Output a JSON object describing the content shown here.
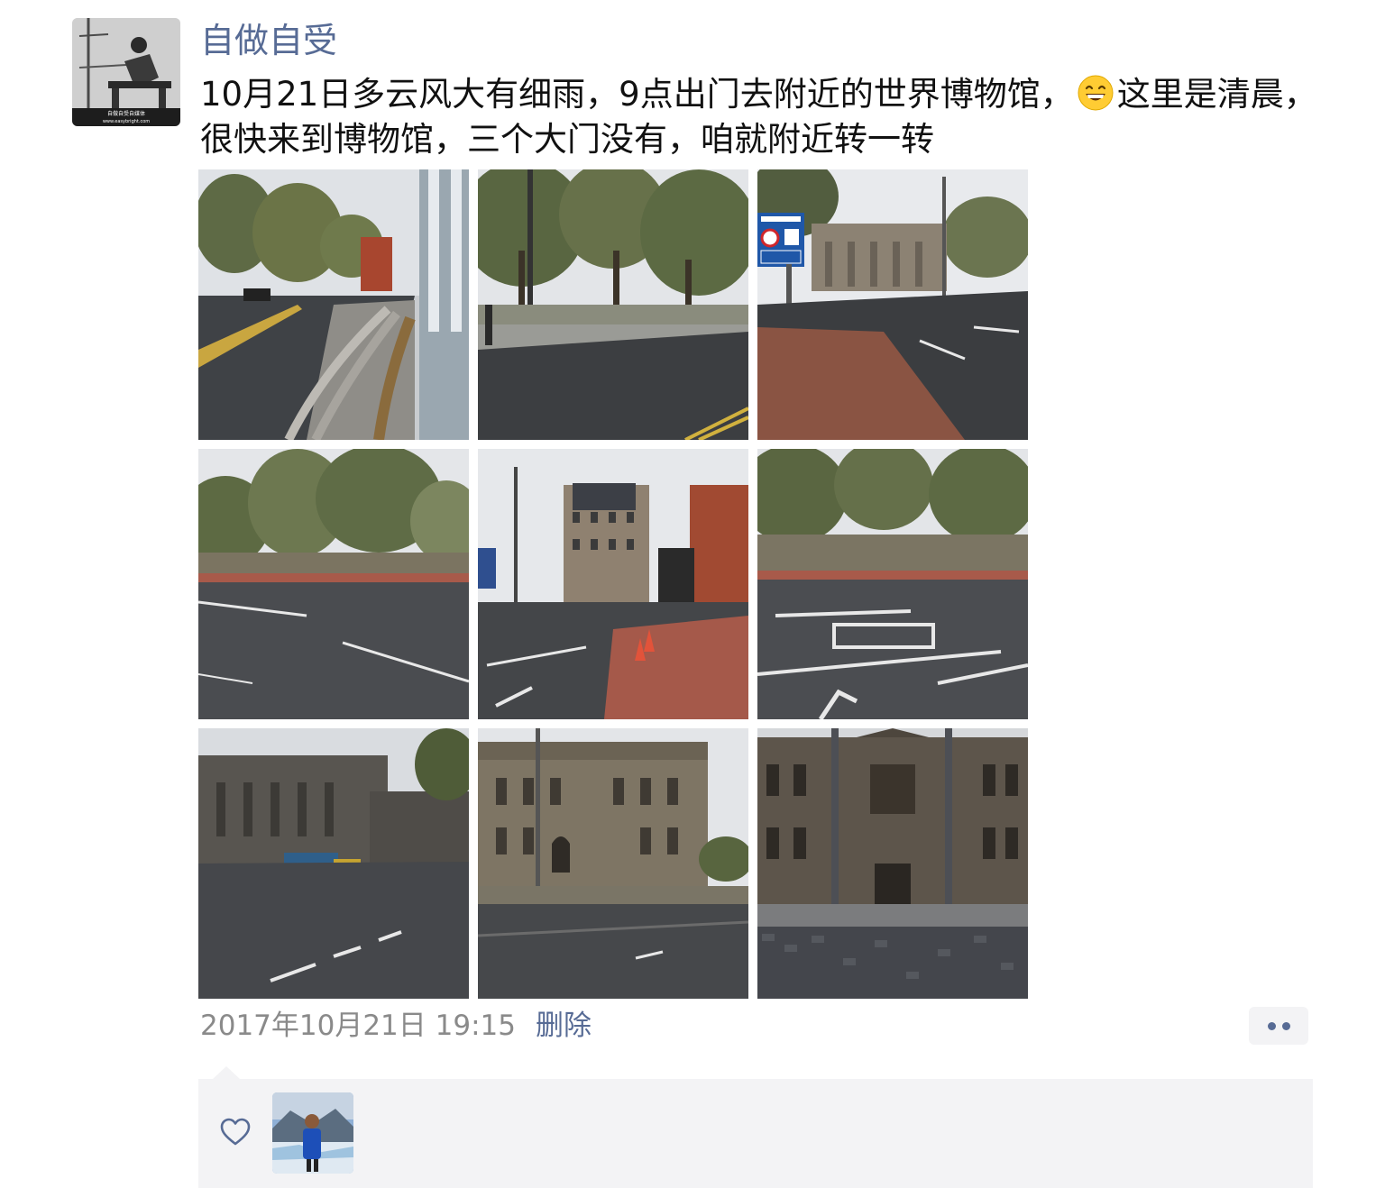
{
  "post": {
    "author": "自做自受",
    "text_part1": "10月21日多云风大有细雨，9点出门去附近的世界博物馆，",
    "text_part2": "这里是清晨，很快来到博物馆，三个大门没有，咱就附近转一转",
    "emoji": "grinning-face-emoji",
    "timestamp": "2017年10月21日 19:15",
    "delete_label": "删除",
    "avatar_watermark": "自做自受自媒体",
    "avatar_url_text": "www.easybright.com"
  },
  "photos": [
    {
      "name": "photo-street-steps",
      "description_icon": "street-photo"
    },
    {
      "name": "photo-trees-road",
      "description_icon": "street-photo"
    },
    {
      "name": "photo-tunnel-sign",
      "description_icon": "street-photo"
    },
    {
      "name": "photo-park-road",
      "description_icon": "street-photo"
    },
    {
      "name": "photo-junction-buildings",
      "description_icon": "street-photo"
    },
    {
      "name": "photo-road-markings",
      "description_icon": "street-photo"
    },
    {
      "name": "photo-museum-wide",
      "description_icon": "building-photo"
    },
    {
      "name": "photo-curved-building",
      "description_icon": "building-photo"
    },
    {
      "name": "photo-museum-facade",
      "description_icon": "building-photo"
    }
  ],
  "likes": {
    "icon": "heart-outline-icon",
    "liker_avatar": "liker-avatar"
  },
  "colors": {
    "link_blue": "#576b95",
    "meta_gray": "#8a8a8a",
    "panel_bg": "#f3f3f5"
  }
}
